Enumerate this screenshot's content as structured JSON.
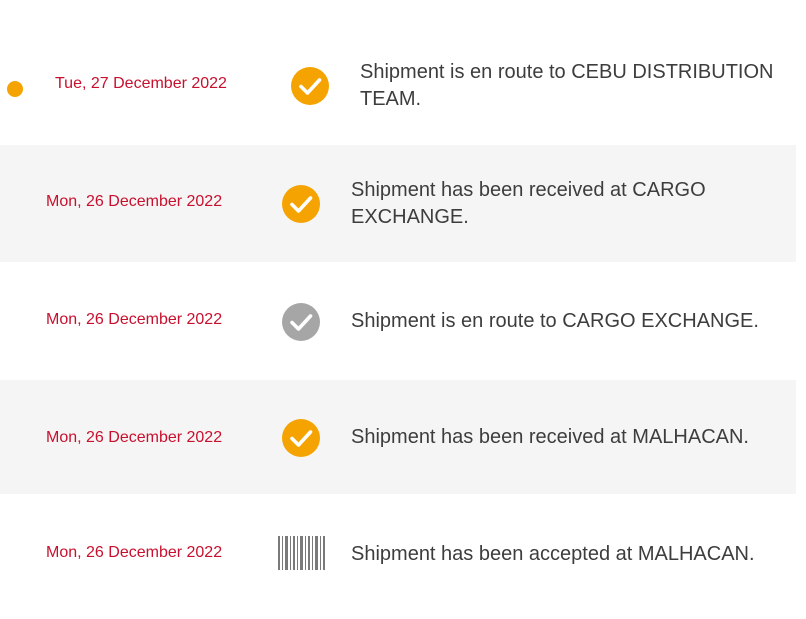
{
  "timeline": {
    "events": [
      {
        "date": "Tue, 27 December 2022",
        "icon": "check-circle-icon",
        "status": "complete",
        "description": "Shipment is en route to CEBU DISTRIBUTION TEAM."
      },
      {
        "date": "Mon, 26 December 2022",
        "icon": "check-circle-icon",
        "status": "complete",
        "description": "Shipment has been received at CARGO EXCHANGE."
      },
      {
        "date": "Mon, 26 December 2022",
        "icon": "check-circle-icon",
        "status": "pending",
        "description": "Shipment is en route to CARGO EXCHANGE."
      },
      {
        "date": "Mon, 26 December 2022",
        "icon": "check-circle-icon",
        "status": "complete",
        "description": "Shipment has been received at MALHACAN."
      },
      {
        "date": "Mon, 26 December 2022",
        "icon": "barcode-icon",
        "status": "accepted",
        "description": "Shipment has been accepted at MALHACAN."
      }
    ]
  },
  "colors": {
    "accent": "#f5a300",
    "date_text": "#c8102e",
    "pending_icon": "#a6a6a6",
    "row_alt_bg": "#f5f5f5",
    "body_text": "#3d3d3d"
  }
}
